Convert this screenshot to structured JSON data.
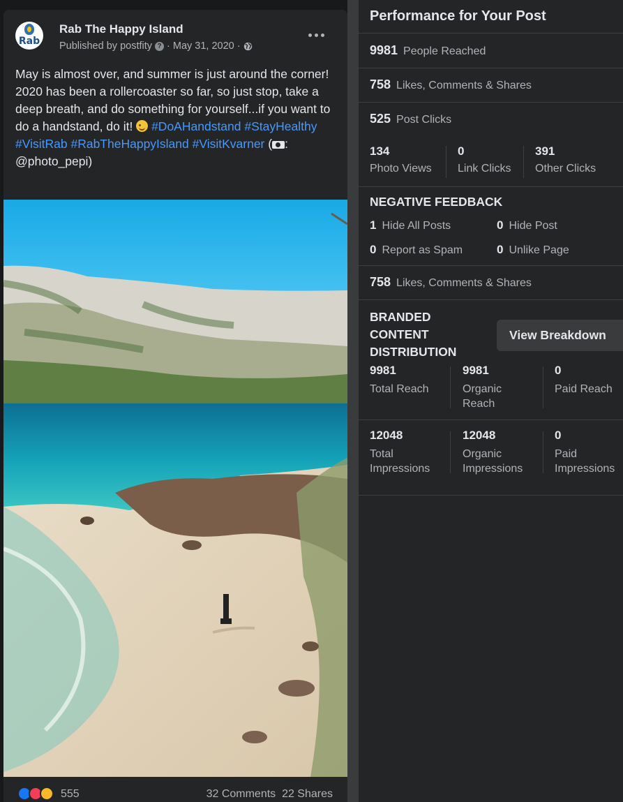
{
  "post": {
    "page_name": "Rab The Happy Island",
    "avatar_text": "Rab",
    "published_prefix": "Published by",
    "publisher": "postfity",
    "date": "May 31, 2020",
    "text_intro": "May is almost over, and summer is just around the corner! 2020 has been a rollercoaster so far, so just stop, take a deep breath, and do something for yourself...if you want to do a handstand, do it! ",
    "hashtags": [
      "#DoAHandstand",
      "#StayHealthy",
      "#VisitRab",
      "#RabTheHappyIsland",
      "#VisitKvarner"
    ],
    "credit_open": " (",
    "credit_close": ":",
    "credit_handle": "@photo_pepi)",
    "reaction_count": "555",
    "comments": "32 Comments",
    "shares": "22 Shares"
  },
  "performance": {
    "title": "Performance for Your Post",
    "people_reached": {
      "num": "9981",
      "label": "People Reached"
    },
    "engagement": {
      "num": "758",
      "label": "Likes, Comments & Shares"
    },
    "post_clicks": {
      "num": "525",
      "label": "Post Clicks"
    },
    "clicks_breakdown": [
      {
        "num": "134",
        "label": "Photo Views"
      },
      {
        "num": "0",
        "label": "Link Clicks"
      },
      {
        "num": "391",
        "label": "Other Clicks"
      }
    ],
    "negative_title": "NEGATIVE FEEDBACK",
    "negative": [
      {
        "num": "1",
        "label": "Hide All Posts"
      },
      {
        "num": "0",
        "label": "Hide Post"
      },
      {
        "num": "0",
        "label": "Report as Spam"
      },
      {
        "num": "0",
        "label": "Unlike Page"
      }
    ],
    "engagement_repeat": {
      "num": "758",
      "label": "Likes, Comments & Shares"
    },
    "branded_title": "BRANDED CONTENT DISTRIBUTION",
    "view_breakdown": "View Breakdown",
    "reach": [
      {
        "num": "9981",
        "label": "Total Reach"
      },
      {
        "num": "9981",
        "label": "Organic Reach"
      },
      {
        "num": "0",
        "label": "Paid Reach"
      }
    ],
    "impressions": [
      {
        "num": "12048",
        "label": "Total Impressions"
      },
      {
        "num": "12048",
        "label": "Organic Impressions"
      },
      {
        "num": "0",
        "label": "Paid Impressions"
      }
    ]
  },
  "colors": {
    "background": "#18191a",
    "card": "#242526",
    "text_primary": "#e4e6eb",
    "text_secondary": "#b0b3b8",
    "hashtag": "#4599ff",
    "like_blue": "#1877f2"
  }
}
